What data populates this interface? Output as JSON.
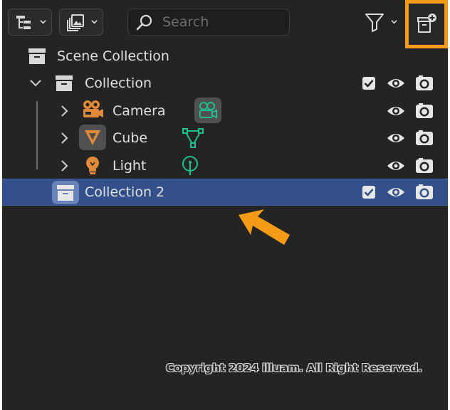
{
  "header": {
    "display_mode_icon": "outliner-tree-icon",
    "filter_type_icon": "image-stack-icon",
    "search": {
      "placeholder": "Search",
      "value": ""
    },
    "filter_icon": "funnel-icon",
    "new_collection_icon": "new-collection-icon"
  },
  "tree": {
    "scene_collection": {
      "label": "Scene Collection",
      "icon": "scene-collection-icon"
    },
    "collection": {
      "label": "Collection",
      "icon": "collection-icon",
      "expanded": true,
      "included": true
    },
    "children": [
      {
        "label": "Camera",
        "icon": "camera-object-icon",
        "data_icon": "camera-data-icon"
      },
      {
        "label": "Cube",
        "icon": "mesh-object-icon",
        "data_icon": "mesh-data-icon"
      },
      {
        "label": "Light",
        "icon": "light-object-icon",
        "data_icon": "light-data-icon"
      }
    ],
    "collection2": {
      "label": "Collection 2",
      "icon": "collection-icon",
      "selected": true,
      "included": true
    }
  },
  "colors": {
    "panel_bg": "#242424",
    "selection": "#33508c",
    "highlight": "#f59b17",
    "object_orange": "#e08a3a",
    "data_green": "#1fbf8f"
  },
  "footer": {
    "copyright": "Copyright 2024 illuam. All Right Reserved."
  }
}
